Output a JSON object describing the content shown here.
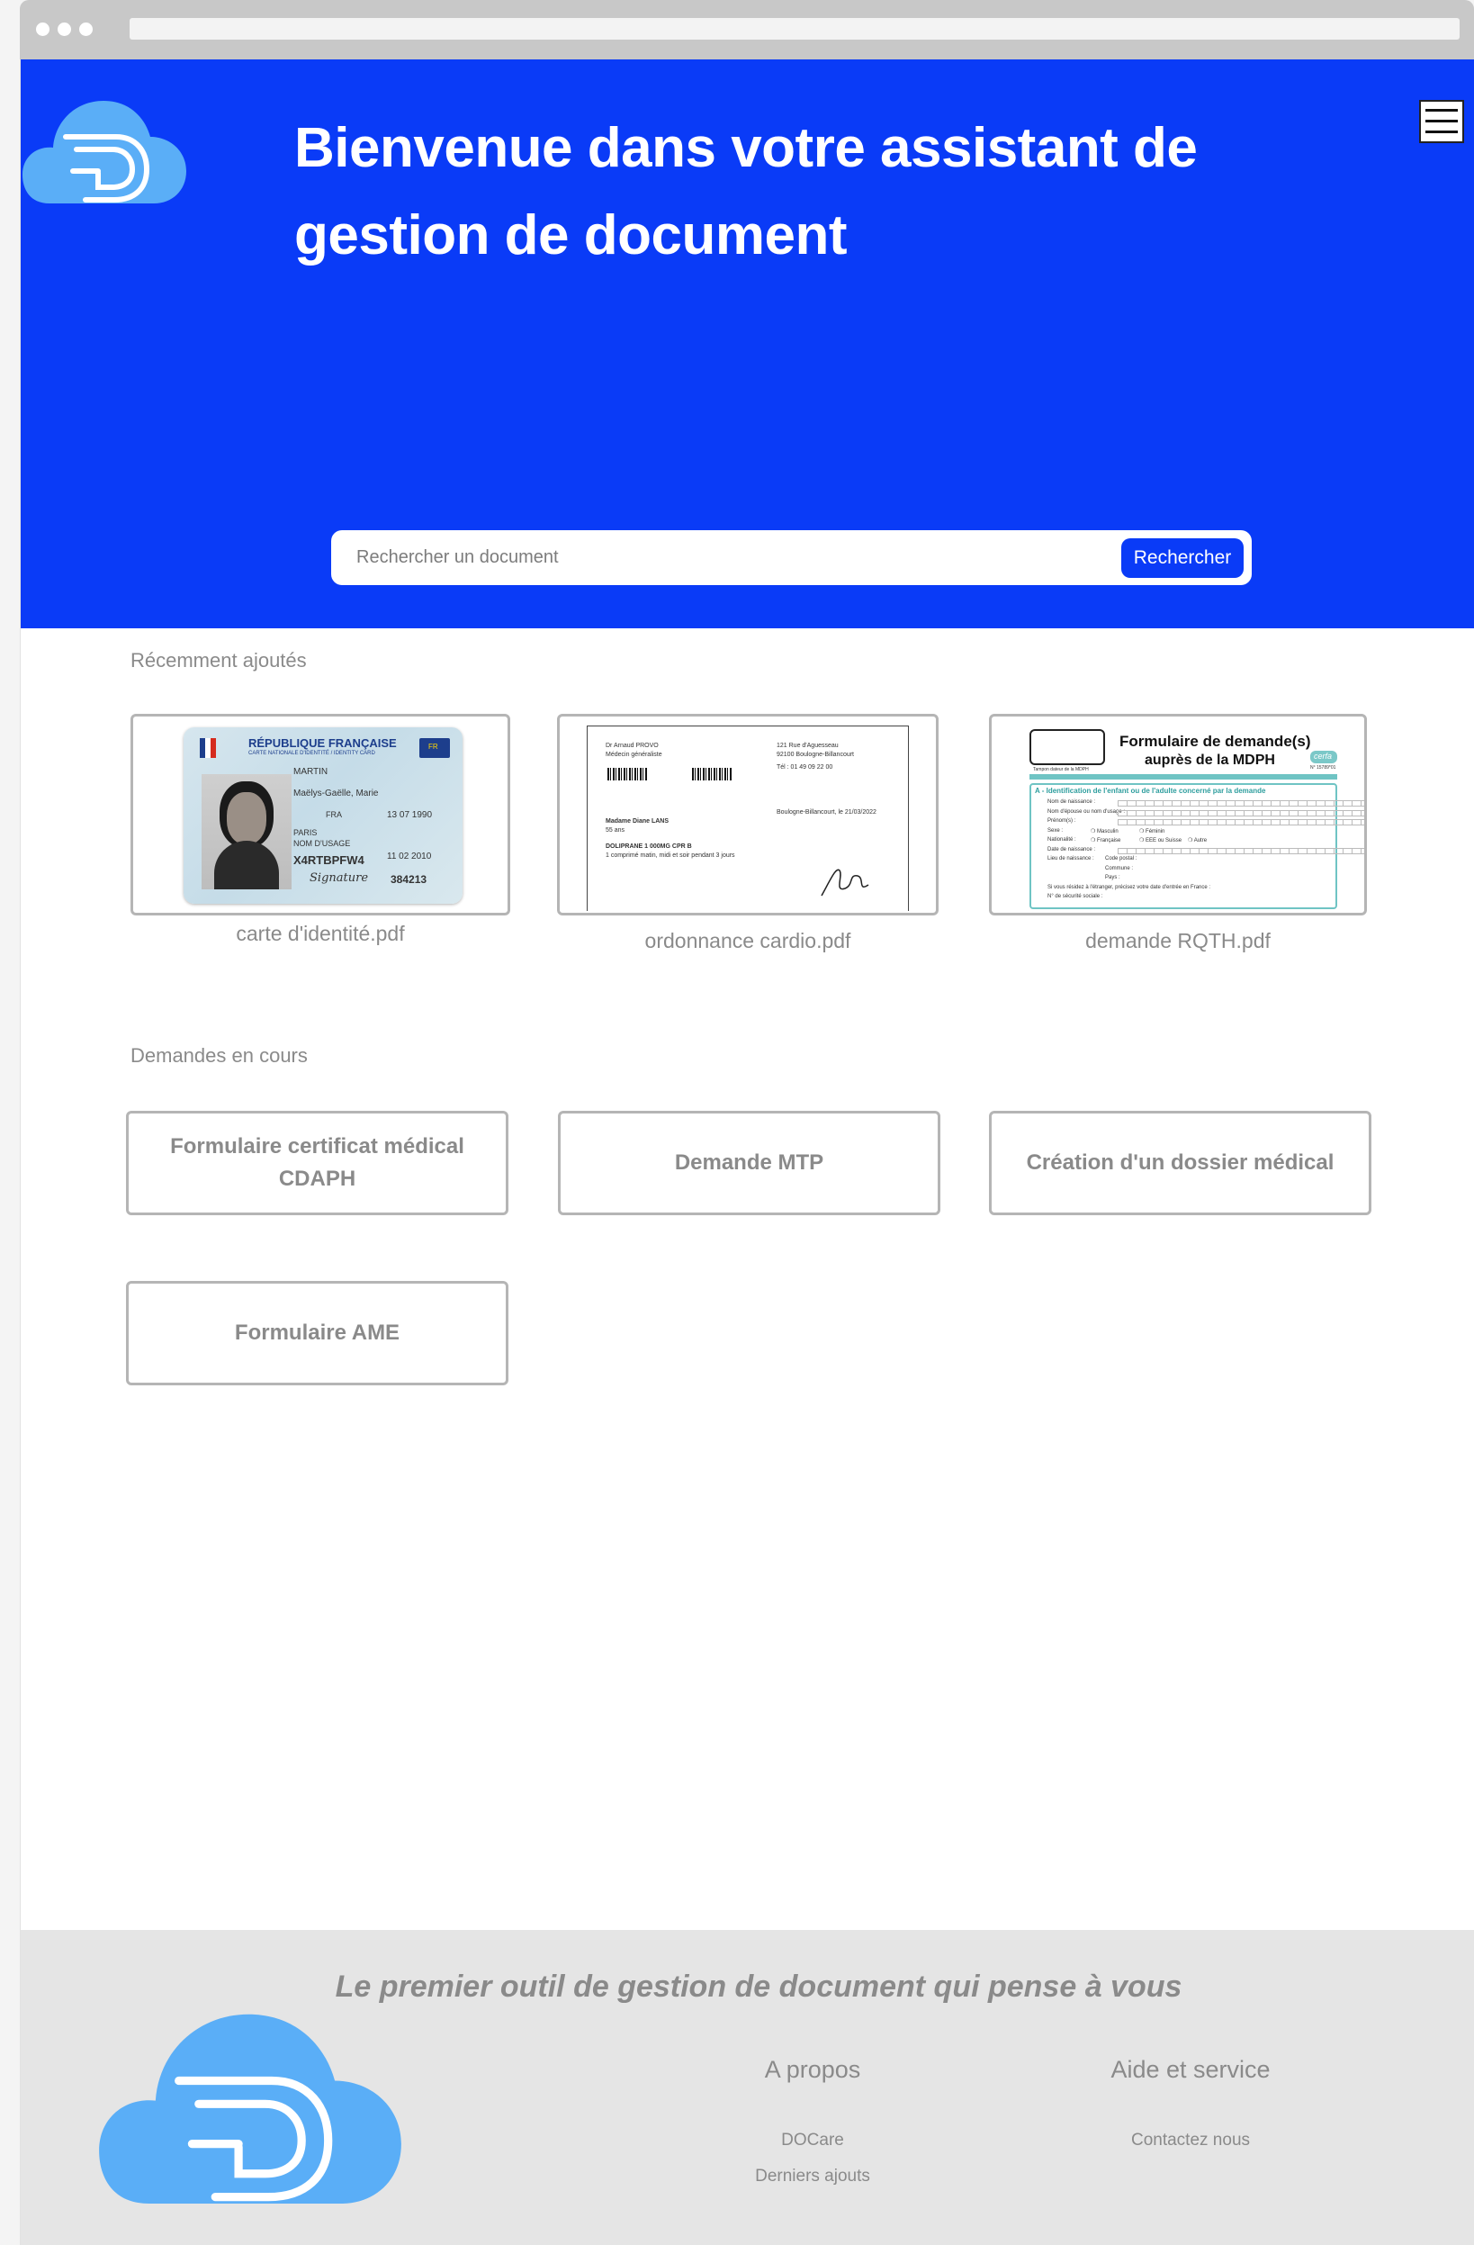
{
  "hero": {
    "title": "Bienvenue dans votre assistant de gestion de document",
    "search_placeholder": "Rechercher un document",
    "search_button": "Rechercher"
  },
  "recent": {
    "label": "Récemment ajoutés",
    "documents": [
      {
        "name": "carte d'identité.pdf"
      },
      {
        "name": "ordonnance cardio.pdf"
      },
      {
        "name": "demande RQTH.pdf"
      }
    ]
  },
  "requests": {
    "label": "Demandes en cours",
    "items": [
      "Formulaire certificat médical CDAPH",
      "Demande MTP",
      "Création d'un dossier médical",
      "Formulaire AME"
    ]
  },
  "id_card": {
    "country": "RÉPUBLIQUE FRANÇAISE",
    "subtitle": "CARTE NATIONALE D'IDENTITÉ / IDENTITY CARD",
    "surname": "MARTIN",
    "given_names": "Maëlys-Gaëlle, Marie",
    "nationality": "FRA",
    "birth_date": "13 07 1990",
    "birth_place": "PARIS",
    "usage_name_label": "NOM D'USAGE",
    "number": "X4RTBPFW4",
    "expiry": "11 02 2010",
    "can": "384213",
    "signature": "Signature",
    "badge": "FR"
  },
  "prescription": {
    "doctor": "Dr Arnaud PROVO",
    "specialty": "Médecin généraliste",
    "address1": "121 Rue d'Aguesseau",
    "address2": "92100 Boulogne-Billancourt",
    "phone": "Tél : 01 49 09 22 00",
    "place_date": "Boulogne-Billancourt, le 21/03/2022",
    "patient": "Madame Diane LANS",
    "age": "55 ans",
    "drug": "DOLIPRANE 1 000MG CPR B",
    "dosage": "1 comprimé matin, midi et soir pendant 3 jours"
  },
  "mdph_form": {
    "title_line1": "Formulaire de demande(s)",
    "title_line2": "auprès de la MDPH",
    "stamp": "Tampon dateur de la MDPH",
    "cerfa": "cerfa",
    "cerfa_number": "N° 15789*01",
    "section": "A - Identification de l'enfant ou de l'adulte concerné par la demande",
    "fields": [
      "Nom de naissance :",
      "Nom d'épouse ou nom d'usage :",
      "Prénom(s) :",
      "Sexe :",
      "Nationalité :",
      "Date de naissance :",
      "Lieu de naissance :",
      "",
      "",
      "Si vous résidez à l'étranger, précisez votre date d'entrée en France :",
      "N° de sécurité sociale :"
    ],
    "sexe_options": [
      "Masculin",
      "Féminin"
    ],
    "nat_options": [
      "Française",
      "EEE ou Suisse",
      "Autre"
    ],
    "lieu_fields": [
      "Code postal :",
      "Commune :",
      "Pays :"
    ]
  },
  "footer": {
    "tagline": "Le  premier outil de gestion de document qui pense à vous",
    "about_title": "A propos",
    "about_links": [
      "DOCare",
      "Derniers ajouts"
    ],
    "help_title": "Aide et service",
    "help_links": [
      "Contactez nous"
    ]
  },
  "colors": {
    "primary": "#0a3bf7",
    "logo": "#5aaef7",
    "muted_text": "#8a8a8a",
    "border": "#b5b5b5",
    "footer_bg": "#e5e5e5"
  },
  "icons": {
    "logo": "cloud-d-logo",
    "menu": "hamburger-menu-icon"
  }
}
